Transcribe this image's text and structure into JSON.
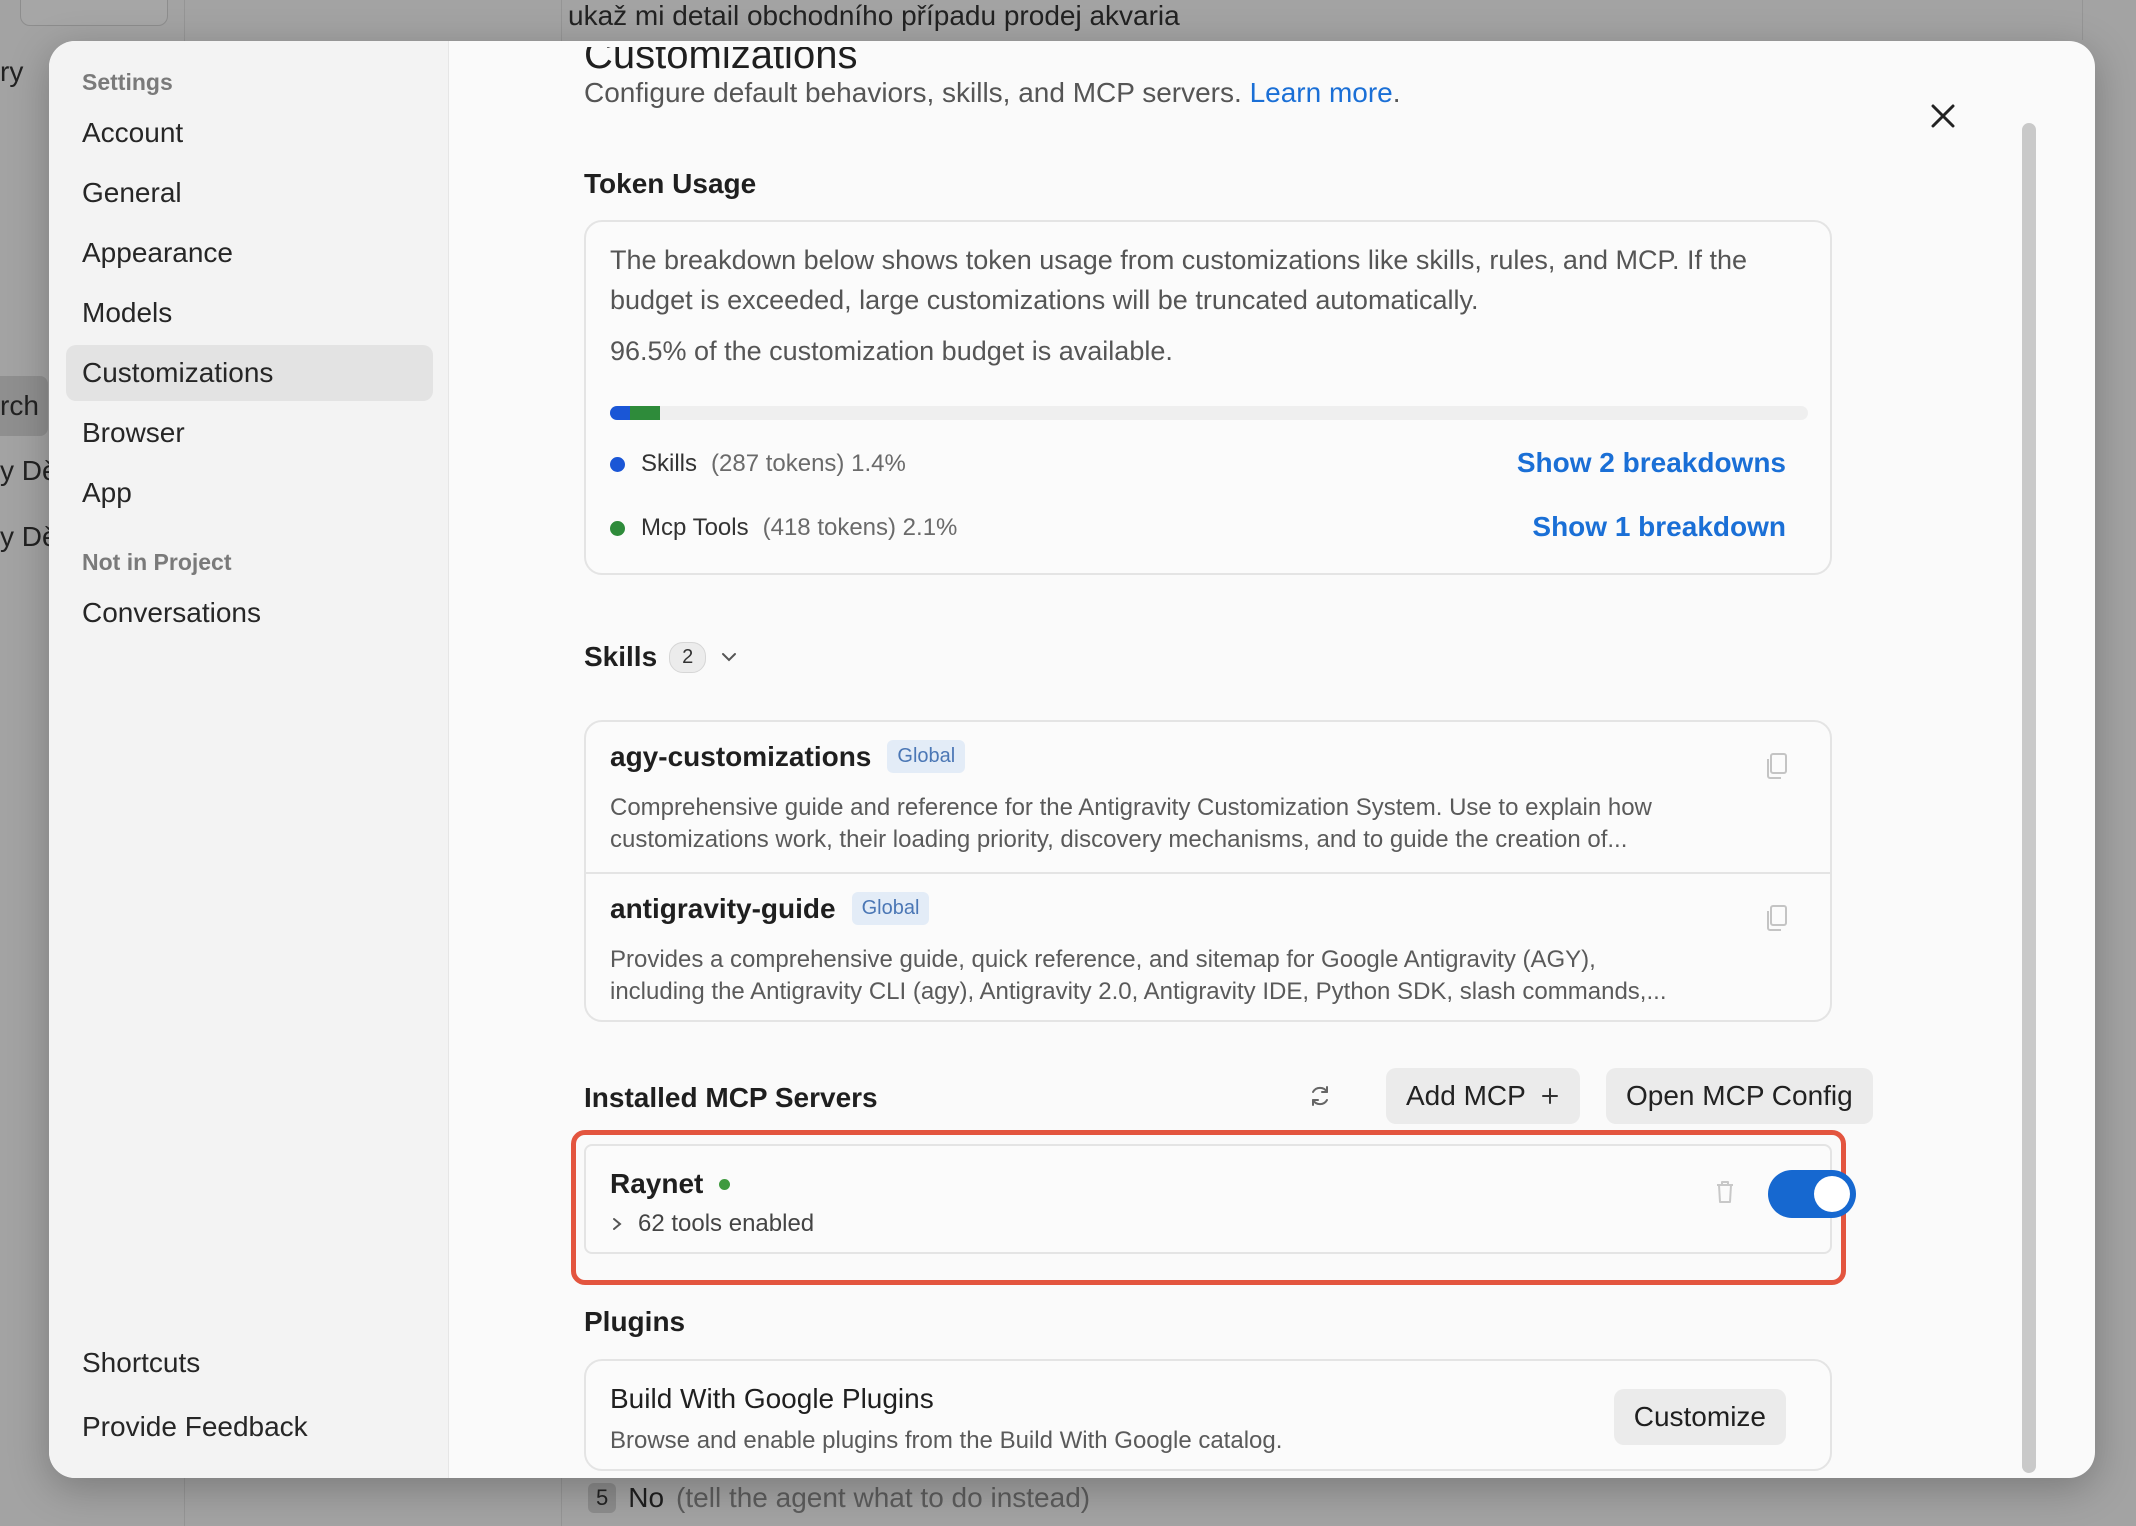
{
  "background": {
    "chat_prompt": "ukaž mi detail obchodního případu prodej akvaria",
    "left_fragments": [
      "ry",
      "rch",
      "y Dě",
      "y Dě"
    ],
    "bottom_option": {
      "number": "5",
      "label": "No",
      "hint": "(tell the agent what to do instead)"
    }
  },
  "sidebar": {
    "group_settings": "Settings",
    "items": [
      {
        "label": "Account"
      },
      {
        "label": "General"
      },
      {
        "label": "Appearance"
      },
      {
        "label": "Models"
      },
      {
        "label": "Customizations",
        "active": true
      },
      {
        "label": "Browser"
      },
      {
        "label": "App"
      }
    ],
    "group_project": "Not in Project",
    "project_items": [
      {
        "label": "Conversations"
      }
    ],
    "footer_items": [
      {
        "label": "Shortcuts"
      },
      {
        "label": "Provide Feedback"
      }
    ]
  },
  "page": {
    "title": "Customizations",
    "description": "Configure default behaviors, skills, and MCP servers.",
    "learn_more": "Learn more",
    "close_icon": "close-icon"
  },
  "token_usage": {
    "title": "Token Usage",
    "explanation": "The breakdown below shows token usage from customizations like skills, rules, and MCP. If the budget is exceeded, large customizations will be truncated automatically.",
    "available": "96.5% of the customization budget is available.",
    "rows": [
      {
        "label": "Skills",
        "detail": "(287 tokens) 1.4%",
        "percent": 1.4,
        "color": "#1a56d6",
        "link": "Show 2 breakdowns"
      },
      {
        "label": "Mcp Tools",
        "detail": "(418 tokens) 2.1%",
        "percent": 2.1,
        "color": "#2e8b3a",
        "link": "Show 1 breakdown"
      }
    ]
  },
  "skills": {
    "title": "Skills",
    "count": "2",
    "items": [
      {
        "name": "agy-customizations",
        "scope": "Global",
        "desc_line1": "Comprehensive guide and reference for the Antigravity Customization System. Use to explain how",
        "desc_line2": "customizations work, their loading priority, discovery mechanisms, and to guide the creation of..."
      },
      {
        "name": "antigravity-guide",
        "scope": "Global",
        "desc_line1": "Provides a comprehensive guide, quick reference, and sitemap for Google Antigravity (AGY),",
        "desc_line2": "including the Antigravity CLI (agy), Antigravity 2.0, Antigravity IDE, Python SDK, slash commands,..."
      }
    ]
  },
  "mcp": {
    "title": "Installed MCP Servers",
    "add_label": "Add MCP",
    "open_config_label": "Open MCP Config",
    "servers": [
      {
        "name": "Raynet",
        "status_color": "#3f9a3f",
        "tools": "62 tools enabled",
        "enabled": true
      }
    ]
  },
  "plugins": {
    "title": "Plugins",
    "items": [
      {
        "name": "Build With Google Plugins",
        "desc": "Browse and enable plugins from the Build With Google catalog.",
        "button": "Customize"
      }
    ]
  }
}
